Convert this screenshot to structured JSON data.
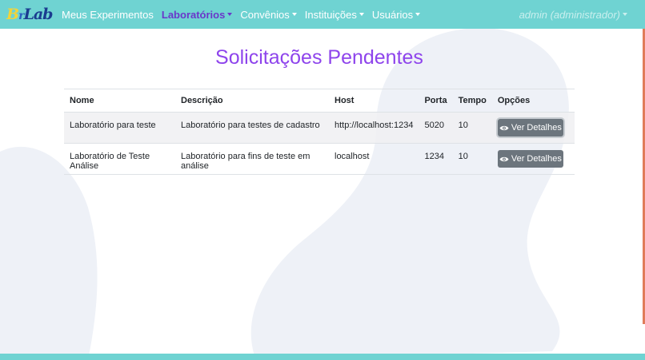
{
  "brand": {
    "logo_text_b": "B",
    "logo_text_r": "r",
    "logo_text_lab": "Lab"
  },
  "nav": {
    "items": [
      {
        "label": "Meus Experimentos",
        "dropdown": false,
        "active": false
      },
      {
        "label": "Laboratórios",
        "dropdown": true,
        "active": true
      },
      {
        "label": "Convênios",
        "dropdown": true,
        "active": false
      },
      {
        "label": "Instituições",
        "dropdown": true,
        "active": false
      },
      {
        "label": "Usuários",
        "dropdown": true,
        "active": false
      }
    ],
    "user": "admin (administrador)"
  },
  "page": {
    "title": "Solicitações Pendentes"
  },
  "table": {
    "headers": [
      "Nome",
      "Descrição",
      "Host",
      "Porta",
      "Tempo",
      "Opções"
    ],
    "rows": [
      {
        "nome": "Laboratório para teste",
        "descricao": "Laboratório para testes de cadastro",
        "host": "http://localhost:1234",
        "porta": "5020",
        "tempo": "10",
        "action": "Ver Detalhes"
      },
      {
        "nome": "Laboratório de Teste Análise",
        "descricao": "Laboratório para fins de teste em análise",
        "host": "localhost",
        "porta": "1234",
        "tempo": "10",
        "action": "Ver Detalhes"
      }
    ]
  },
  "colors": {
    "navbar": "#6fd3d2",
    "title": "#8e44ec",
    "active_nav": "#6a37c9",
    "button": "#6c757d"
  },
  "icons": {
    "details_button": "eye-icon",
    "nav_dropdown": "caret-down-icon"
  }
}
